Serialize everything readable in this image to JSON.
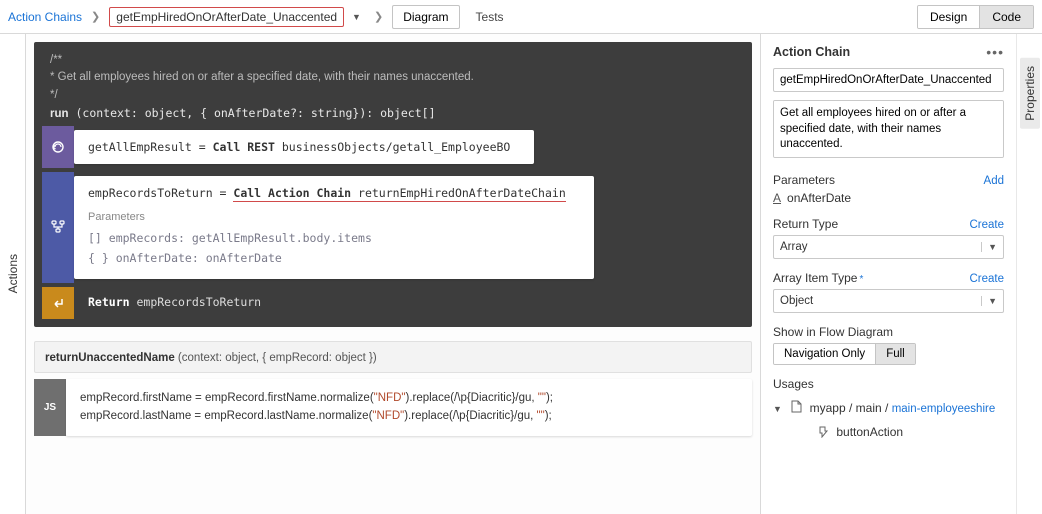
{
  "topbar": {
    "root": "Action Chains",
    "current": "getEmpHiredOnOrAfterDate_Unaccented",
    "diagram_btn": "Diagram",
    "tests_tab": "Tests",
    "design_btn": "Design",
    "code_btn": "Code"
  },
  "left_rail": {
    "label": "Actions"
  },
  "code": {
    "comment_open": "/**",
    "comment_body": " * Get all employees hired on or after a specified date, with their names unaccented.",
    "comment_close": " */",
    "signature": "run (context: object, { onAfterDate?: string}): object[]",
    "step1": {
      "lhs": "getAllEmpResult = ",
      "call_kw": "Call REST",
      "path": " businessObjects/getall_EmployeeBO"
    },
    "step2": {
      "lhs": "empRecordsToReturn = ",
      "call_kw": "Call Action Chain",
      "target": " returnEmpHiredOnAfterDateChain",
      "params_label": "Parameters",
      "param1": "[] empRecords: getAllEmpResult.body.items",
      "param2": "{ } onAfterDate: onAfterDate"
    },
    "step3": {
      "kw": "Return",
      "val": " empRecordsToReturn"
    },
    "fn2": {
      "name": "returnUnaccentedName",
      "sig_rest": " (context: object, { empRecord: object })",
      "line1_a": "empRecord.firstName = empRecord.firstName.normalize(",
      "nfd": "\"NFD\"",
      "line1_b": ").replace(/\\p{Diacritic}/gu, ",
      "empty": "\"\"",
      "line1_c": ");",
      "line2_a": "empRecord.lastName = empRecord.lastName.normalize("
    }
  },
  "panel": {
    "title": "Action Chain",
    "id_value": "getEmpHiredOnOrAfterDate_Unaccented",
    "desc_value": "Get all employees hired on or after a specified date, with their names unaccented.",
    "params_label": "Parameters",
    "add_label": "Add",
    "param_name": "onAfterDate",
    "return_type_label": "Return Type",
    "create_label": "Create",
    "return_type_value": "Array",
    "array_item_label": "Array Item Type",
    "array_item_value": "Object",
    "show_label": "Show in Flow Diagram",
    "show_nav": "Navigation Only",
    "show_full": "Full",
    "usages_label": "Usages",
    "usage_app": "myapp",
    "usage_main": "main",
    "usage_page": "main-employeeshire",
    "usage_leaf": "buttonAction",
    "sep": " / "
  },
  "far_tab": {
    "label": "Properties"
  }
}
